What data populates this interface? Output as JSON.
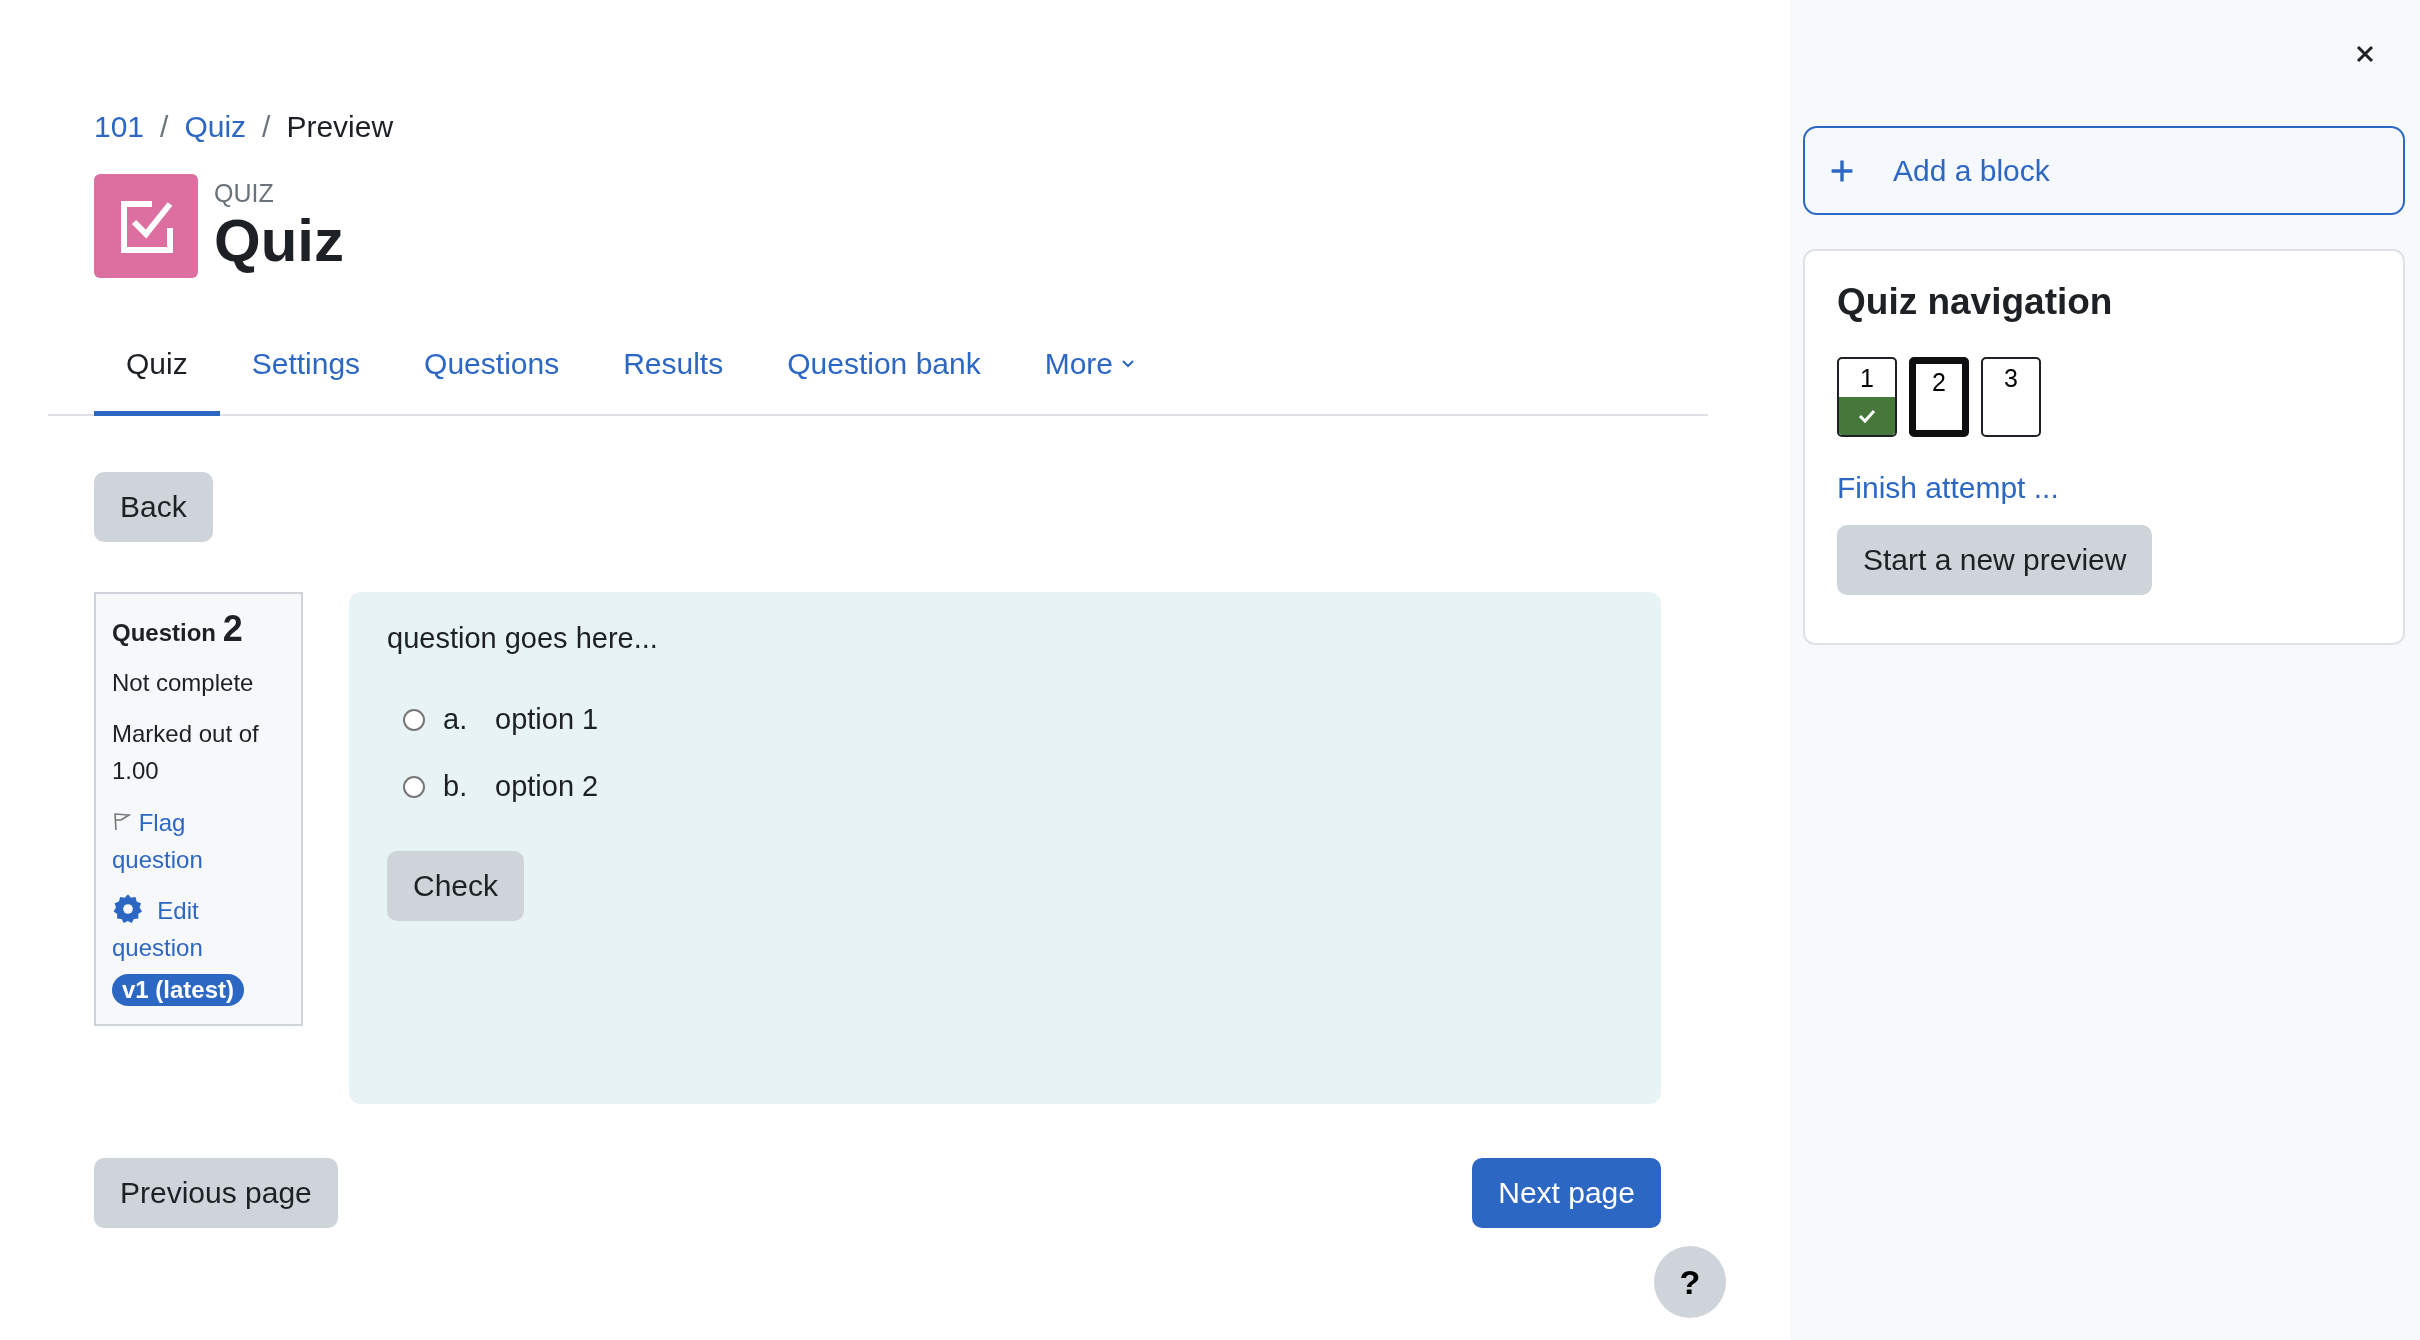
{
  "breadcrumb": [
    {
      "label": "101",
      "link": true
    },
    {
      "label": "Quiz",
      "link": true
    },
    {
      "label": "Preview",
      "link": false
    }
  ],
  "breadcrumb_separator": "/",
  "header": {
    "category": "QUIZ",
    "title": "Quiz"
  },
  "tabs": [
    {
      "label": "Quiz",
      "selected": true,
      "kind": "tab"
    },
    {
      "label": "Settings",
      "selected": false,
      "kind": "tab"
    },
    {
      "label": "Questions",
      "selected": false,
      "kind": "tab"
    },
    {
      "label": "Results",
      "selected": false,
      "kind": "tab"
    },
    {
      "label": "Question bank",
      "selected": false,
      "kind": "tab"
    },
    {
      "label": "More",
      "selected": false,
      "kind": "dropdown"
    }
  ],
  "back_button": "Back",
  "question_info": {
    "heading": "Question",
    "number": "2",
    "status": "Not complete",
    "marks": "Marked out of 1.00",
    "flag_link": "Flag question",
    "edit_link": "Edit question",
    "version": "v1 (latest)"
  },
  "question": {
    "text": "question goes here...",
    "options": [
      {
        "letter": "a.",
        "text": "option 1",
        "selected": false
      },
      {
        "letter": "b.",
        "text": "option 2",
        "selected": false
      }
    ],
    "check_button": "Check"
  },
  "previous_button": "Previous page",
  "next_button": "Next page",
  "help_button": "?",
  "drawer": {
    "add_block": "Add a block",
    "navigation": {
      "title": "Quiz navigation",
      "questions": [
        {
          "number": "1",
          "answered": true,
          "selected": false
        },
        {
          "number": "2",
          "answered": false,
          "selected": true
        },
        {
          "number": "3",
          "answered": false,
          "selected": false
        }
      ],
      "finish_link": "Finish attempt ...",
      "new_preview_button": "Start a new preview"
    }
  }
}
